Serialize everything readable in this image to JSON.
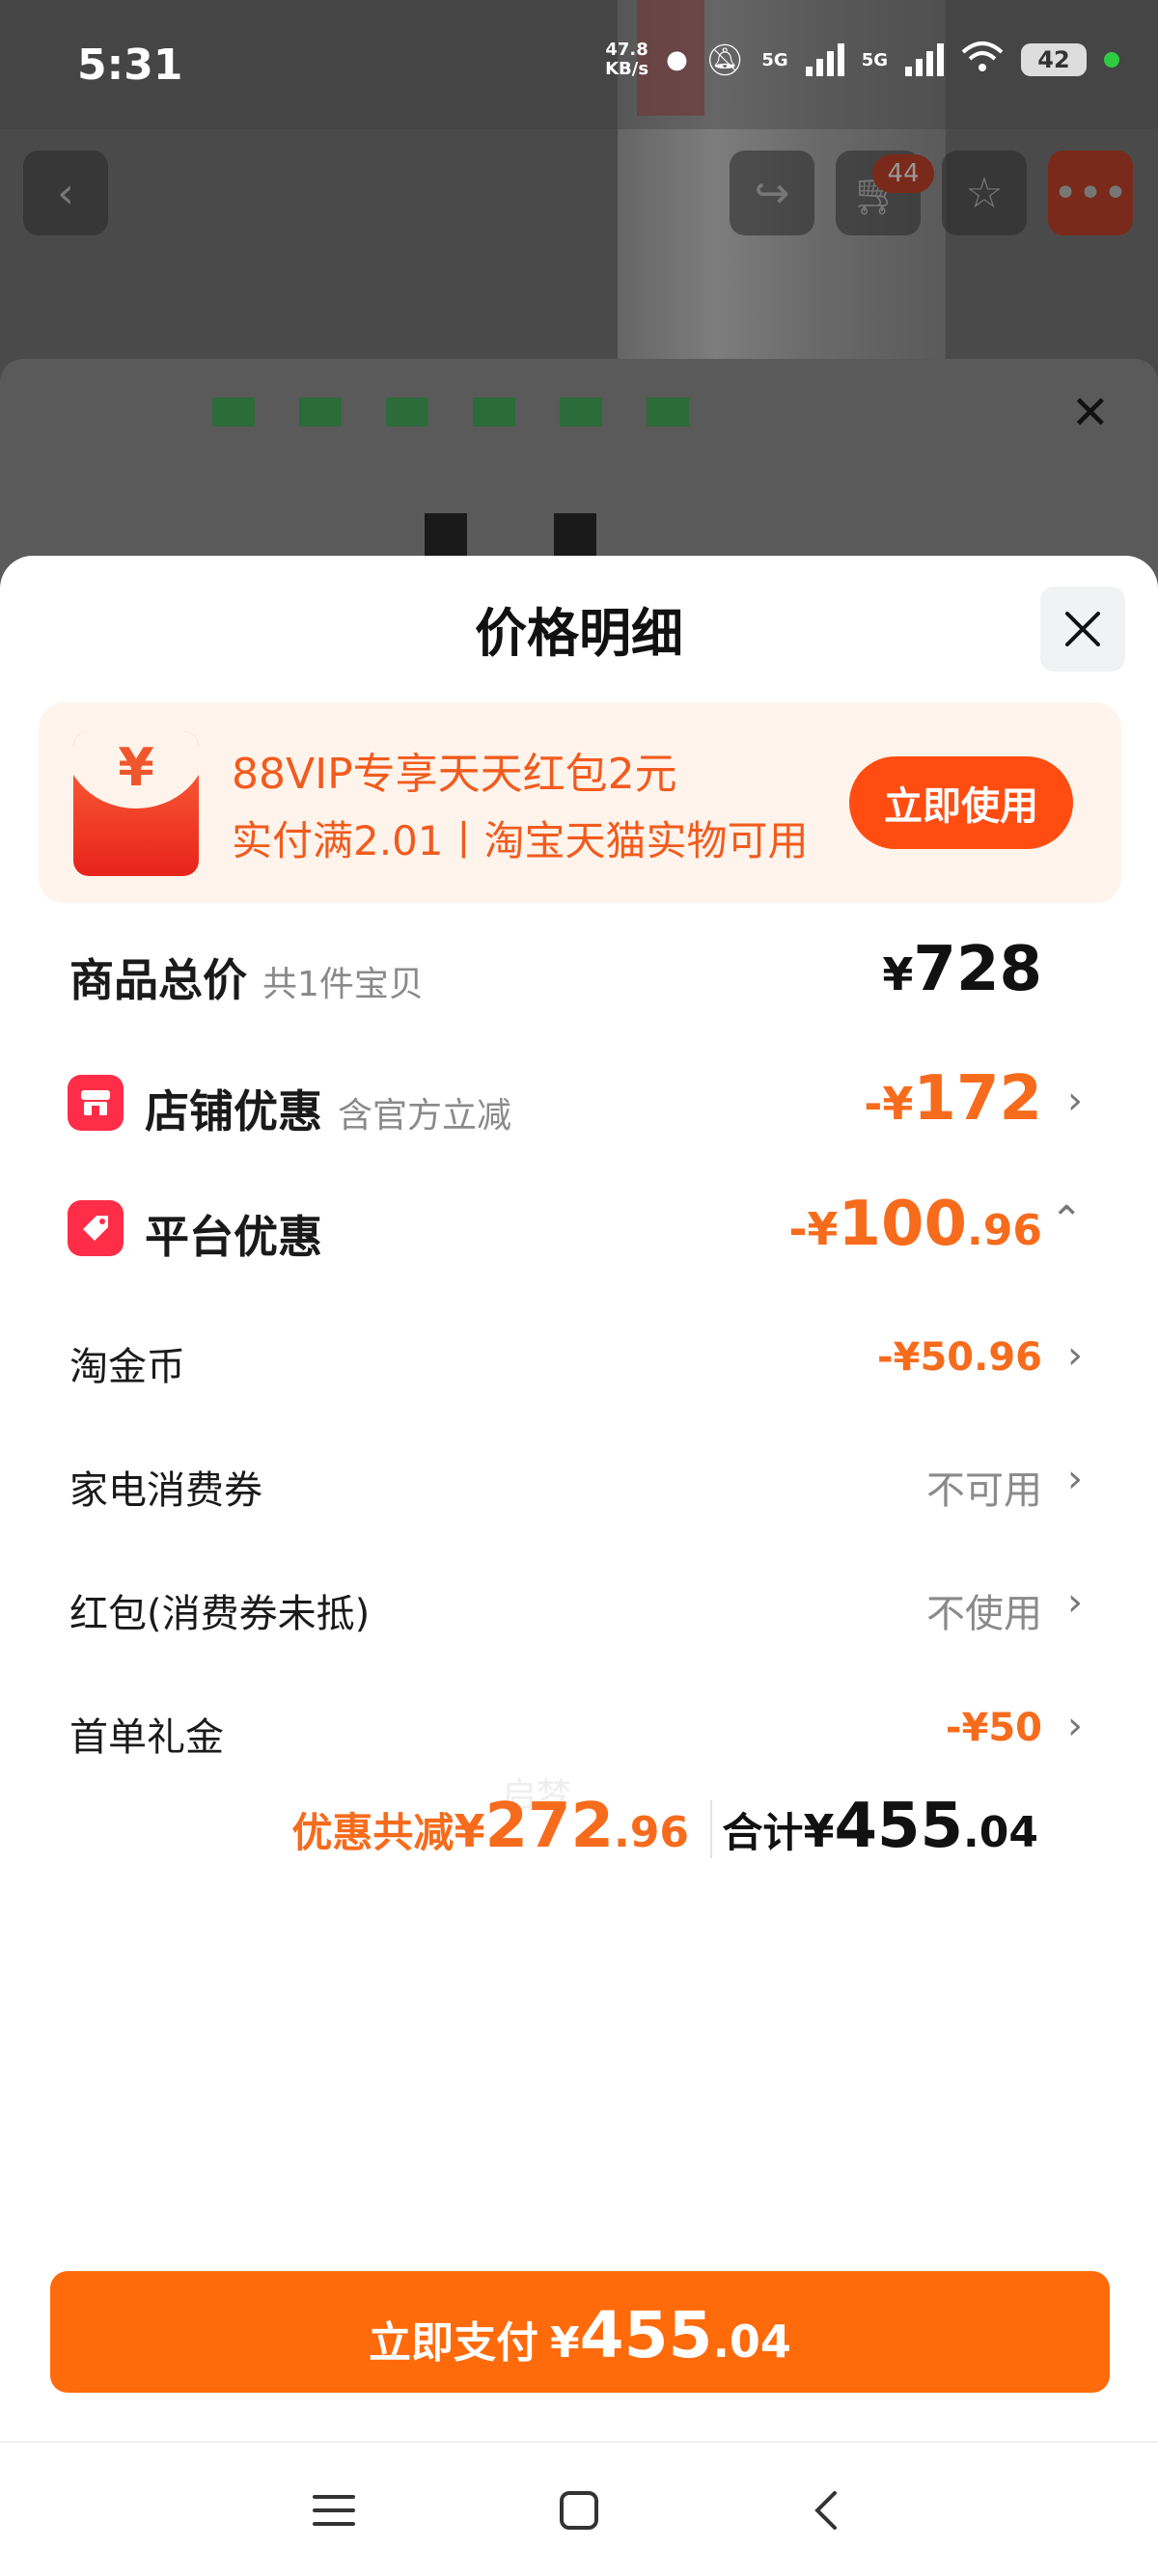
{
  "status_bar": {
    "time": "5:31",
    "net_speed_value": "47.8",
    "net_speed_unit": "KB/s",
    "sim1": "5G",
    "sim2": "5G",
    "battery": "42"
  },
  "background": {
    "cart_badge": "44"
  },
  "sheet": {
    "title": "价格明细"
  },
  "vip_card": {
    "line1": "88VIP专享天天红包2元",
    "line2": "实付满2.01丨淘宝天猫实物可用",
    "button": "立即使用",
    "icon_glyph": "¥"
  },
  "rows": {
    "total": {
      "label": "商品总价",
      "sub": "共1件宝贝",
      "yen": "¥",
      "amount": "728"
    },
    "store": {
      "label": "店铺优惠",
      "sub": "含官方立减",
      "prefix": "-¥",
      "amount": "172"
    },
    "platform": {
      "label": "平台优惠",
      "prefix": "-¥",
      "amount_int": "100",
      "amount_dec": ".96"
    },
    "coins": {
      "label": "淘金币",
      "value": "-¥50.96"
    },
    "appliance": {
      "label": "家电消费券",
      "value": "不可用"
    },
    "redpacket": {
      "label": "红包(消费券未抵)",
      "value": "不使用"
    },
    "first_order": {
      "label": "首单礼金",
      "value": "-¥50"
    }
  },
  "summary": {
    "discount_label": "优惠共减",
    "discount_yen": "¥",
    "discount_int": "272",
    "discount_dec": ".96",
    "total_label": "合计",
    "total_yen": "¥",
    "total_int": "455",
    "total_dec": ".04"
  },
  "watermark": "启梦",
  "pay_button": {
    "label": "立即支付",
    "yen": "¥",
    "int": "455",
    "dec": ".04"
  },
  "colors": {
    "accent_orange": "#ff6a0a",
    "discount_orange": "#f76b1c",
    "vip_red": "#ff4d12",
    "icon_red": "#ff2d47"
  }
}
